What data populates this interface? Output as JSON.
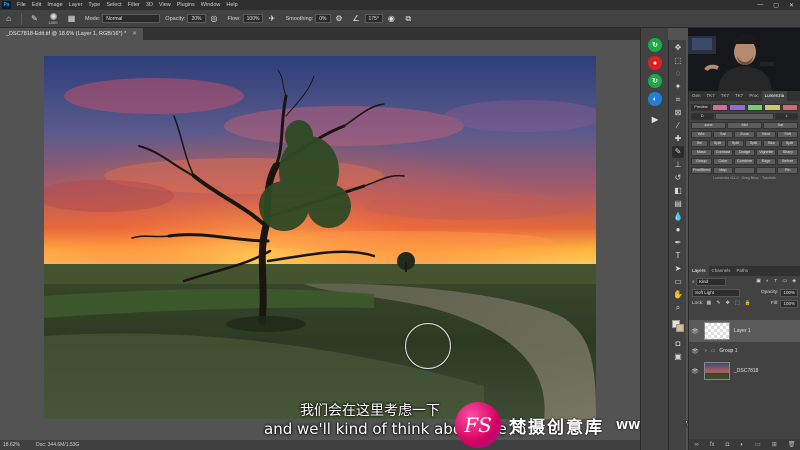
{
  "app": {
    "logo": "Ps",
    "menu": [
      "File",
      "Edit",
      "Image",
      "Layer",
      "Type",
      "Select",
      "Filter",
      "3D",
      "View",
      "Plugins",
      "Window",
      "Help"
    ],
    "window_controls": [
      "—",
      "▢",
      "✕"
    ]
  },
  "options_bar": {
    "brush_size": "1000",
    "mode_label": "Mode:",
    "mode_value": "Normal",
    "opacity_label": "Opacity:",
    "opacity_value": "20%",
    "flow_label": "Flow:",
    "flow_value": "100%",
    "smoothing_label": "Smoothing:",
    "smoothing_value": "0%",
    "angle_value": "175°"
  },
  "document": {
    "tab_title": "_DSC7818-Edit.tif @ 18.6% (Layer 1, RGB/16*) *",
    "zoom": "18.62%",
    "doc_size": "Doc: 344.6M/1.53G"
  },
  "subtitles": {
    "cn": "我们会在这里考虑一下",
    "en": "and we'll kind of think about the fo"
  },
  "watermark": {
    "logo": "FS",
    "name_cn": "梵摄创意库",
    "url": "WWW.FSTVC.CC"
  },
  "panel_tabs": [
    "Gen",
    "TK7",
    "TK7",
    "TK7",
    "Proc",
    "Lumenzia"
  ],
  "lumenzia": {
    "preview_label": "Preview",
    "row1": [
      "D",
      "L"
    ],
    "row2": [
      "zone",
      "Mid",
      "Sat"
    ],
    "row3": [
      "Wbr",
      "Sat",
      "Zone",
      "Blnd",
      "Shft"
    ],
    "row4": [
      "Sel",
      "Split",
      "Split",
      "Split",
      "Blur",
      "Split"
    ],
    "row5": [
      "Mask",
      "Contrast",
      "Dodge",
      "Vignette",
      "Sharp"
    ],
    "row6": [
      "Group",
      "Color",
      "Combine",
      "Edge",
      "Before"
    ],
    "row7": [
      "PostBlend",
      "Map",
      "",
      "",
      "Pin"
    ],
    "note": "Lumenzia v11.0 · Greg Benz · Tutorials"
  },
  "layers": {
    "tabs": [
      "Layers",
      "Channels",
      "Paths"
    ],
    "kind_label": "Kind",
    "blend_mode": "Soft Light",
    "opacity_label": "Opacity:",
    "opacity_value": "100%",
    "lock_label": "Lock:",
    "fill_label": "Fill:",
    "fill_value": "100%",
    "items": [
      "Layer 1",
      "Group 1",
      "_DSC7818"
    ]
  },
  "colors": {
    "accent_green": "#1fa84a",
    "accent_red": "#e02020",
    "accent_blue": "#1f7fd6"
  }
}
